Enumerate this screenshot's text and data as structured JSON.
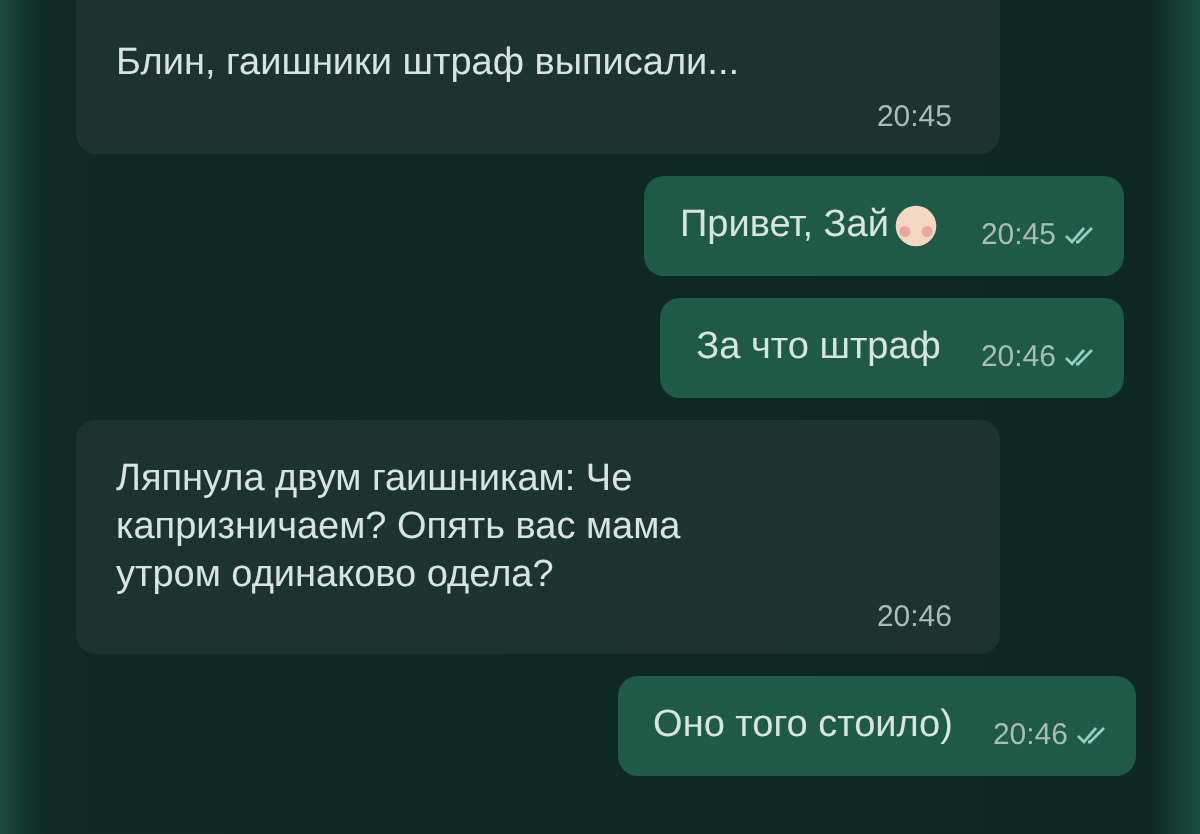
{
  "messages": [
    {
      "kind": "incoming",
      "text": "Блин, гаишники штраф выписали...",
      "time": "20:45"
    },
    {
      "kind": "outgoing",
      "text": "Привет, Зай",
      "emoji": true,
      "time": "20:45",
      "read": true
    },
    {
      "kind": "outgoing",
      "text": "За что штраф",
      "emoji": false,
      "time": "20:46",
      "read": true
    },
    {
      "kind": "incoming",
      "text": "Ляпнула двум гаишникам: Че капризничаем? Опять вас мама утром одинаково одела?",
      "time": "20:46"
    },
    {
      "kind": "outgoing",
      "text": "Оно того стоило)",
      "emoji": false,
      "time": "20:46",
      "read": true
    }
  ]
}
